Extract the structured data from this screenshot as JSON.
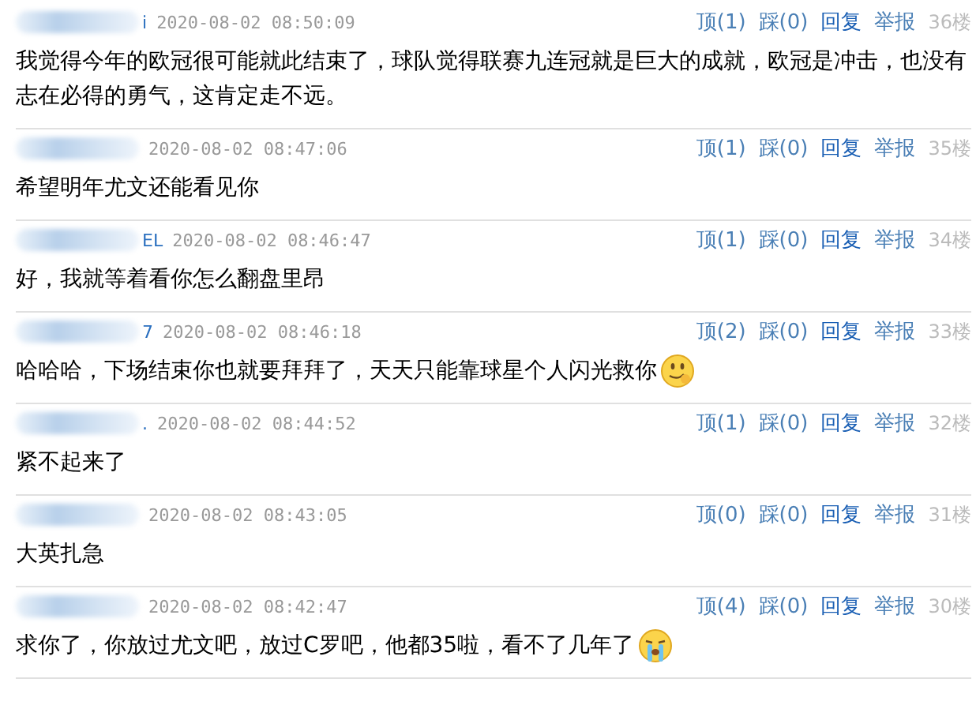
{
  "comments": [
    {
      "name_tail": "i",
      "time": "2020-08-02 08:50:09",
      "text": "我觉得今年的欧冠很可能就此结束了，球队觉得联赛九连冠就是巨大的成就，欧冠是冲击，也没有志在必得的勇气，这肯定走不远。",
      "up": "顶(1)",
      "down": "踩(0)",
      "reply": "回复",
      "report": "举报",
      "floor": "36楼"
    },
    {
      "time": "2020-08-02 08:47:06",
      "text": "希望明年尤文还能看见你",
      "up": "顶(1)",
      "down": "踩(0)",
      "reply": "回复",
      "report": "举报",
      "floor": "35楼"
    },
    {
      "name_tail": "EL",
      "time": "2020-08-02 08:46:47",
      "text": "好，我就等着看你怎么翻盘里昂",
      "up": "顶(1)",
      "down": "踩(0)",
      "reply": "回复",
      "report": "举报",
      "floor": "34楼"
    },
    {
      "name_tail": "7",
      "time": "2020-08-02 08:46:18",
      "text": "哈哈哈，下场结束你也就要拜拜了，天天只能靠球星个人闪光救你",
      "emoji": {
        "kind": "smirk"
      },
      "up": "顶(2)",
      "down": "踩(0)",
      "reply": "回复",
      "report": "举报",
      "floor": "33楼"
    },
    {
      "name_tail": ".",
      "time": "2020-08-02 08:44:52",
      "text": "紧不起来了",
      "up": "顶(1)",
      "down": "踩(0)",
      "reply": "回复",
      "report": "举报",
      "floor": "32楼"
    },
    {
      "time": "2020-08-02 08:43:05",
      "text": "大英扎急",
      "up": "顶(0)",
      "down": "踩(0)",
      "reply": "回复",
      "report": "举报",
      "floor": "31楼"
    },
    {
      "time": "2020-08-02 08:42:47",
      "text": "求你了，你放过尤文吧，放过C罗吧，他都35啦，看不了几年了",
      "emoji": {
        "kind": "cry"
      },
      "up": "顶(4)",
      "down": "踩(0)",
      "reply": "回复",
      "report": "举报",
      "floor": "30楼"
    }
  ]
}
